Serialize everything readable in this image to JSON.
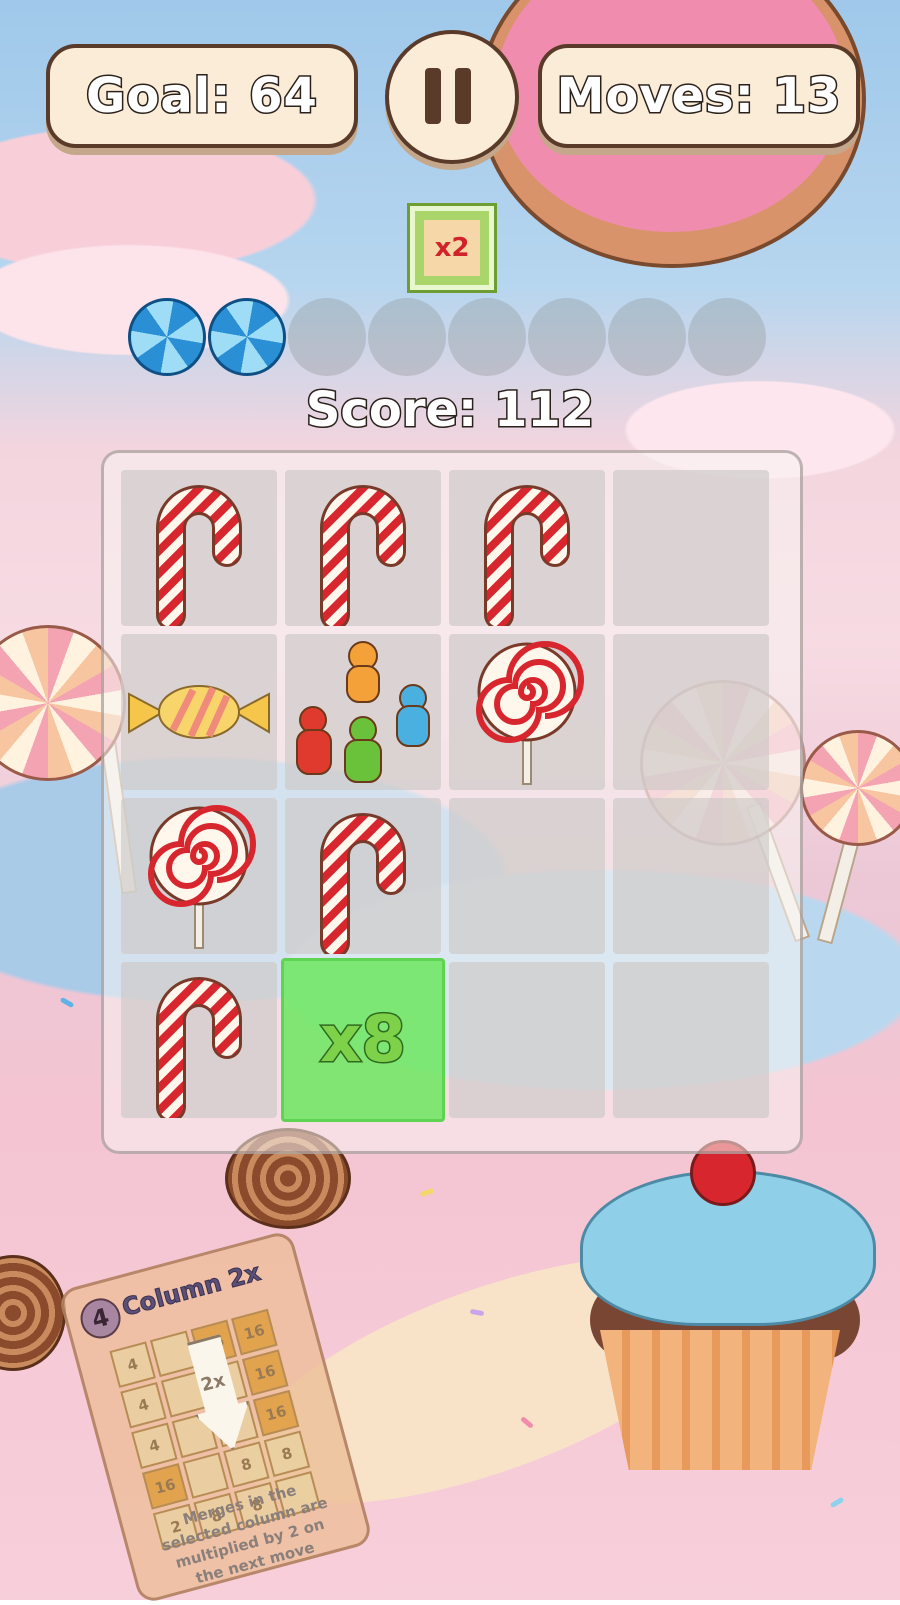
{
  "hud": {
    "goal": "Goal: 64",
    "moves": "Moves: 13",
    "score": "Score: 112"
  },
  "multiplier_badge": "x2",
  "progress": {
    "filled": 2,
    "total": 8
  },
  "board": {
    "rows": [
      [
        "candy-cane",
        "candy-cane",
        "candy-cane",
        "empty"
      ],
      [
        "wrapped-candy",
        "gummy-bears",
        "lollipop",
        "empty"
      ],
      [
        "lollipop",
        "candy-cane",
        "empty",
        "empty"
      ],
      [
        "candy-cane",
        "x8",
        "empty",
        "empty"
      ]
    ],
    "multiplier_cell_label": "x8"
  },
  "power_card": {
    "cost": "4",
    "title": "Column 2x",
    "arrow_label": "2x",
    "grid": [
      [
        "4",
        "",
        "16",
        "16"
      ],
      [
        "4",
        "",
        "",
        "16"
      ],
      [
        "4",
        "",
        "",
        "16"
      ],
      [
        "16",
        "",
        "8",
        "8"
      ],
      [
        "2",
        "8",
        "8",
        ""
      ]
    ],
    "description": "Merges in the selected column are multiplied by 2 on the next move"
  },
  "icons": [
    "pause-icon",
    "candy-cane-icon",
    "lollipop-icon",
    "wrapped-candy-icon",
    "gummy-bears-icon",
    "swirl-orb-icon"
  ],
  "colors": {
    "pill_fill": "#fbecd7",
    "pill_border": "#5a3b2a",
    "multiplier_green": "#6ce65f",
    "badge_green": "#a9d56a"
  }
}
